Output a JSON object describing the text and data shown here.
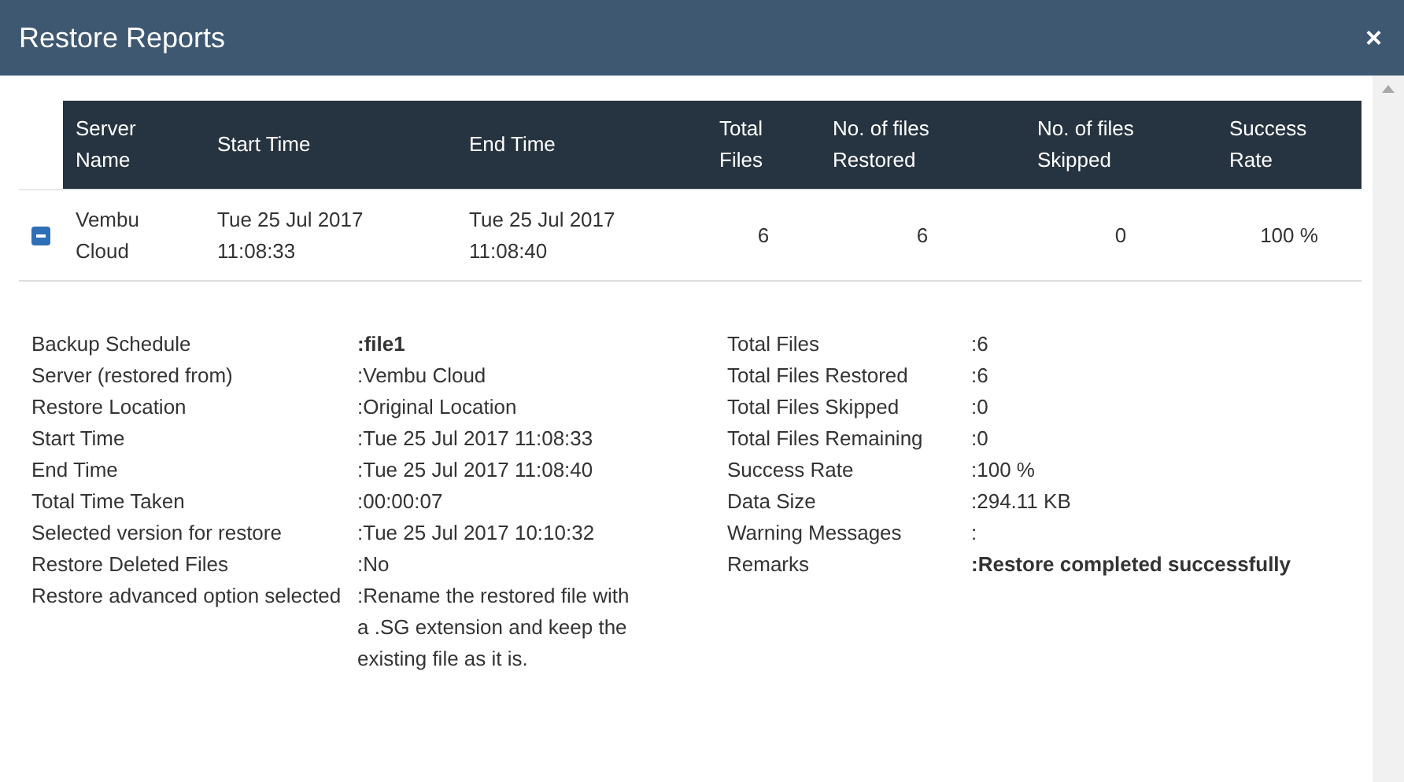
{
  "window": {
    "title": "Restore Reports",
    "close": "×"
  },
  "table": {
    "columns": [
      "Server Name",
      "Start Time",
      "End Time",
      "Total Files",
      "No. of files Restored",
      "No. of files Skipped",
      "Success Rate"
    ],
    "rows": [
      {
        "expanded": true,
        "cells": [
          "Vembu Cloud",
          "Tue 25 Jul 2017 11:08:33",
          "Tue 25 Jul 2017 11:08:40",
          "6",
          "6",
          "0",
          "100 %"
        ]
      }
    ]
  },
  "details": {
    "left": [
      {
        "label": "Backup Schedule",
        "value": ":file1",
        "bold": true
      },
      {
        "label": "Server (restored from)",
        "value": ":Vembu Cloud",
        "bold": false
      },
      {
        "label": "Restore Location",
        "value": ":Original Location",
        "bold": false
      },
      {
        "label": "Start Time",
        "value": ":Tue 25 Jul 2017 11:08:33",
        "bold": false
      },
      {
        "label": "End Time",
        "value": ":Tue 25 Jul 2017 11:08:40",
        "bold": false
      },
      {
        "label": "Total Time Taken",
        "value": ":00:00:07",
        "bold": false
      },
      {
        "label": "Selected version for restore",
        "value": ":Tue 25 Jul 2017 10:10:32",
        "bold": false
      },
      {
        "label": "Restore Deleted Files",
        "value": ":No",
        "bold": false
      },
      {
        "label": "Restore advanced option selected",
        "value": ":Rename the restored file with a .SG extension and keep the existing file as it is.",
        "bold": false
      }
    ],
    "right": [
      {
        "label": "Total Files",
        "value": ":6",
        "bold": false
      },
      {
        "label": "Total Files Restored",
        "value": ":6",
        "bold": false
      },
      {
        "label": "Total Files Skipped",
        "value": ":0",
        "bold": false
      },
      {
        "label": "Total Files Remaining",
        "value": ":0",
        "bold": false
      },
      {
        "label": "Success Rate",
        "value": ":100 %",
        "bold": false
      },
      {
        "label": "Data Size",
        "value": ":294.11 KB",
        "bold": false
      },
      {
        "label": "Warning Messages",
        "value": ":",
        "bold": false
      },
      {
        "label": "Remarks",
        "value": ":Restore completed successfully",
        "bold": true
      }
    ]
  }
}
